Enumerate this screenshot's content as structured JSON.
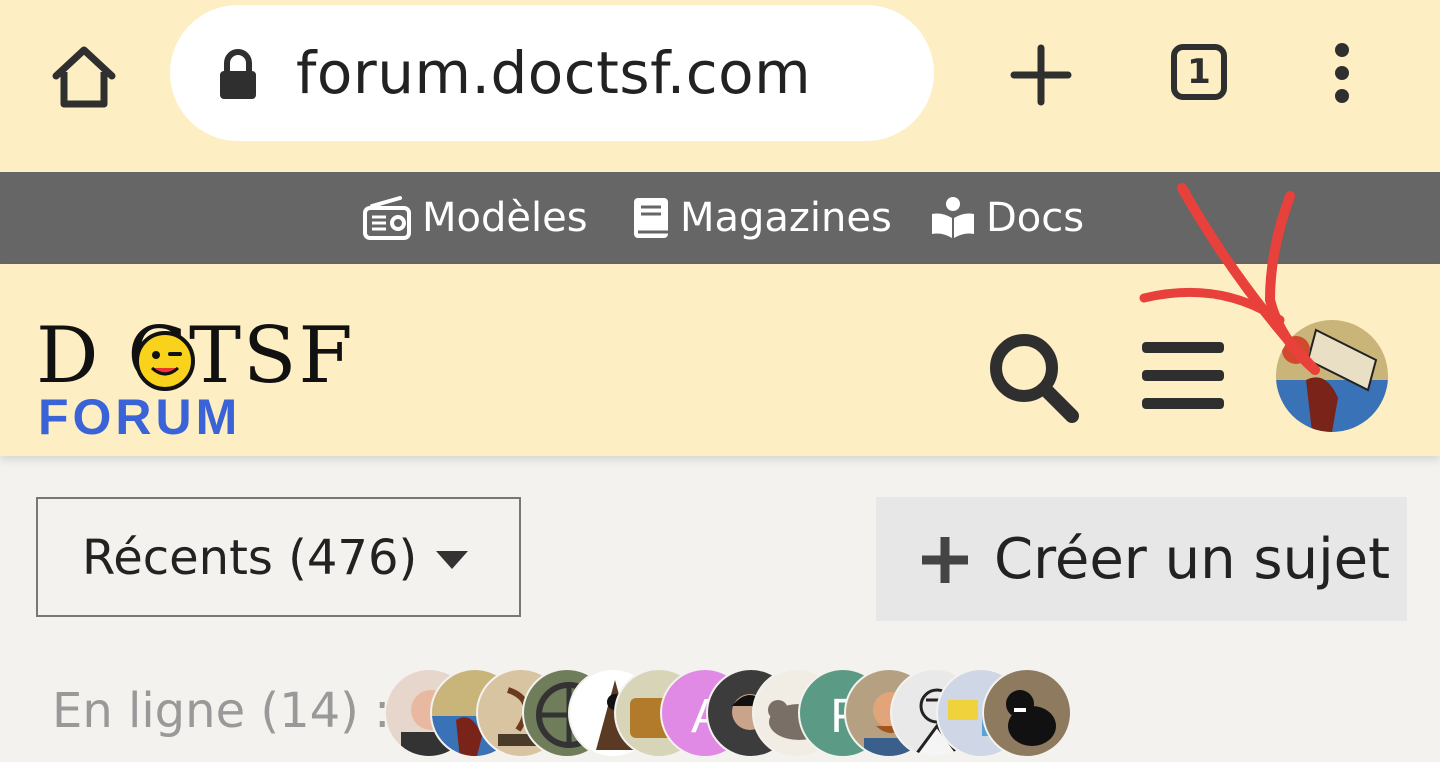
{
  "browser": {
    "url": "forum.doctsf.com",
    "tab_count": "1",
    "icons": {
      "home": "home-icon",
      "lock": "lock-icon",
      "new_tab": "plus-icon",
      "tabs": "tabs-icon",
      "menu": "more-vertical-icon"
    }
  },
  "topnav": {
    "items": [
      {
        "label": "Modèles",
        "icon": "radio-icon"
      },
      {
        "label": "Magazines",
        "icon": "book-icon"
      },
      {
        "label": "Docs",
        "icon": "book-reader-icon"
      }
    ]
  },
  "header": {
    "logo_top": "D  CTSF",
    "logo_bottom": "FORUM",
    "icons": {
      "search": "search-icon",
      "menu": "hamburger-icon",
      "avatar": "user-avatar"
    }
  },
  "toolbar": {
    "recent_label": "Récents (476)",
    "create_label": "Créer un sujet"
  },
  "online": {
    "label": "En ligne (14) :",
    "users": [
      {
        "initial": ""
      },
      {
        "initial": ""
      },
      {
        "initial": ""
      },
      {
        "initial": ""
      },
      {
        "initial": ""
      },
      {
        "initial": ""
      },
      {
        "initial": "A"
      },
      {
        "initial": ""
      },
      {
        "initial": ""
      },
      {
        "initial": "F"
      },
      {
        "initial": ""
      },
      {
        "initial": ""
      },
      {
        "initial": ""
      },
      {
        "initial": ""
      }
    ]
  },
  "colors": {
    "chrome_bg": "#fdefc3",
    "nav_bg": "#666666",
    "logo_blue": "#3b63d8",
    "page_bg": "#f3f2ee",
    "annotation": "#e8403a"
  }
}
